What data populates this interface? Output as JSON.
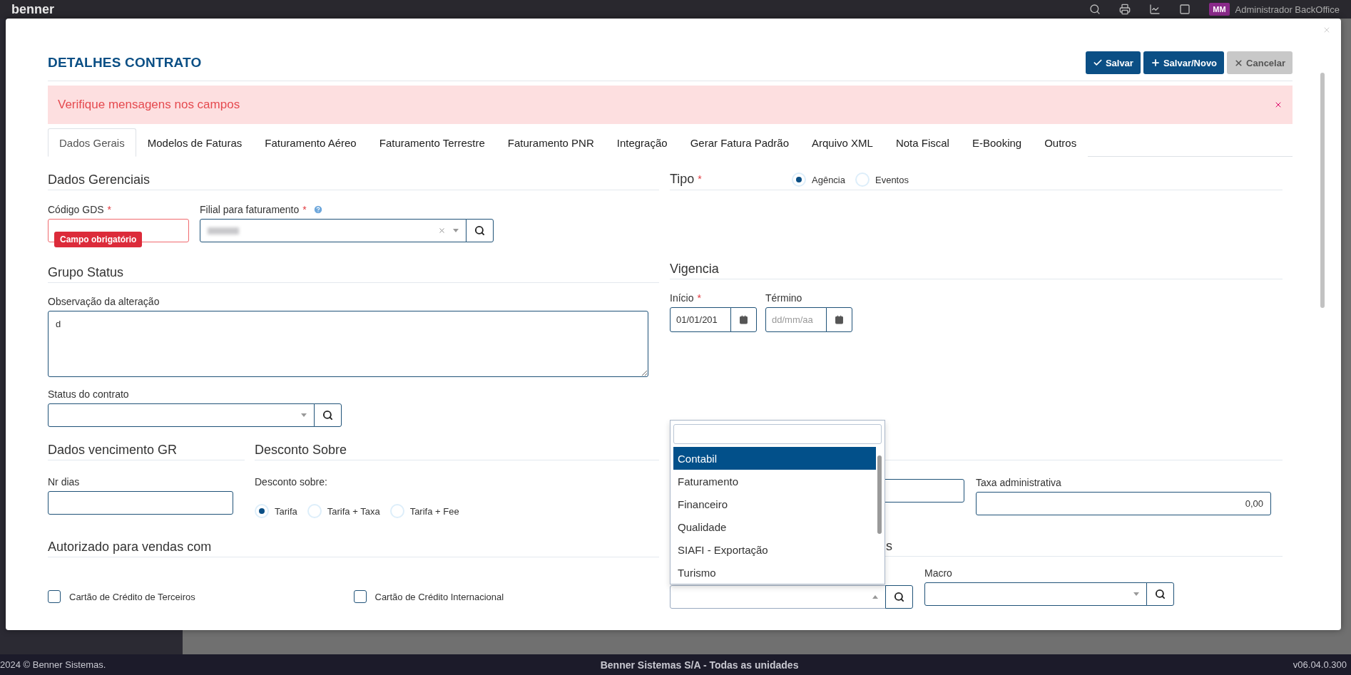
{
  "topbar": {
    "logo": "benner",
    "avatar": "MM",
    "user": "Administrador BackOffice"
  },
  "dialog": {
    "title": "DETALHES CONTRATO",
    "buttons": [
      {
        "kind": "save",
        "label": "Salvar"
      },
      {
        "kind": "save_new",
        "label": "Salvar/Novo"
      },
      {
        "kind": "cancel",
        "label": "Cancelar"
      }
    ],
    "alert": {
      "message": "Verifique mensagens nos campos"
    },
    "tabs": [
      {
        "label": "Dados Gerais",
        "selected": true
      },
      {
        "label": "Modelos de Faturas",
        "selected": false
      },
      {
        "label": "Faturamento Aéreo",
        "selected": false
      },
      {
        "label": "Faturamento Terrestre",
        "selected": false
      },
      {
        "label": "Faturamento PNR",
        "selected": false
      },
      {
        "label": "Integração",
        "selected": false
      },
      {
        "label": "Gerar Fatura Padrão",
        "selected": false
      },
      {
        "label": "Arquivo XML",
        "selected": false
      },
      {
        "label": "Nota Fiscal",
        "selected": false
      },
      {
        "label": "E-Booking",
        "selected": false
      },
      {
        "label": "Outros",
        "selected": false
      }
    ],
    "dados_gerenciais": {
      "title": "Dados Gerenciais",
      "codigo_gds": {
        "label": "Código GDS",
        "required_mark": "*",
        "invalid": true,
        "error": "Campo obrigatório"
      },
      "filial": {
        "label": "Filial para faturamento",
        "required_mark": "*"
      }
    },
    "tipo": {
      "label": "Tipo",
      "required_mark": "*",
      "options": [
        {
          "label": "Agência",
          "selected": true
        },
        {
          "label": "Eventos",
          "selected": false
        }
      ]
    },
    "grupo_status": {
      "title": "Grupo Status",
      "observacao": {
        "label": "Observação da alteração",
        "value": "d"
      },
      "status": {
        "label": "Status do contrato"
      }
    },
    "vigencia": {
      "title": "Vigencia",
      "inicio": {
        "label": "Início",
        "required_mark": "*",
        "value": "01/01/201"
      },
      "termino": {
        "label": "Término",
        "placeholder": "dd/mm/aa"
      }
    },
    "vencimento": {
      "title": "Dados vencimento GR",
      "nr_dias": {
        "label": "Nr dias"
      }
    },
    "desconto": {
      "title": "Desconto Sobre",
      "label": "Desconto sobre:",
      "options": [
        {
          "label": "Tarifa",
          "selected": true
        },
        {
          "label": "Tarifa + Taxa",
          "selected": false
        },
        {
          "label": "Tarifa + Fee",
          "selected": false
        }
      ]
    },
    "taxa": {
      "label": "Taxa administrativa",
      "value": "0,00"
    },
    "autorizado": {
      "title": "Autorizado para vendas com",
      "options": [
        {
          "label": "Cartão de Crédito de Terceiros",
          "checked": false
        },
        {
          "label": "Cartão de Crédito Internacional",
          "checked": false
        }
      ]
    },
    "section_partial": {
      "title": "s"
    },
    "macro": {
      "label": "Macro"
    },
    "dropdown": {
      "options": [
        {
          "label": "Contabil",
          "selected": true
        },
        {
          "label": "Faturamento",
          "selected": false
        },
        {
          "label": "Financeiro",
          "selected": false
        },
        {
          "label": "Qualidade",
          "selected": false
        },
        {
          "label": "SIAFI - Exportação",
          "selected": false
        },
        {
          "label": "Turismo",
          "selected": false
        }
      ]
    }
  },
  "footer": {
    "copyright": "2024 © Benner Sistemas.",
    "company": "Benner Sistemas S/A - Todas as unidades",
    "version": "v06.04.0.300"
  }
}
